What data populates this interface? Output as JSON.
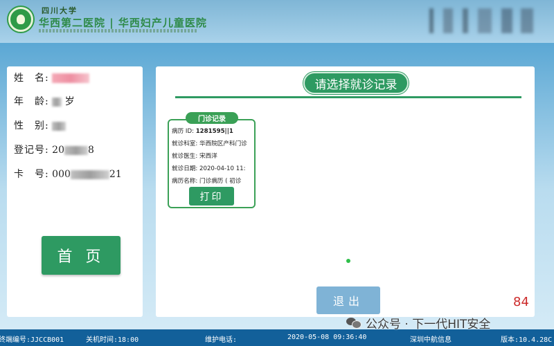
{
  "header": {
    "university": "四川大学",
    "hospital_name": "华西第二医院 | 华西妇产儿童医院"
  },
  "patient": {
    "name_label": "姓　名:",
    "age_label": "年　龄:",
    "age_unit": "岁",
    "gender_label": "性　别:",
    "reg_label": "登记号:",
    "reg_value_prefix": "20",
    "reg_value_suffix": "8",
    "card_label": "卡　号:",
    "card_value_prefix": "000",
    "card_value_suffix": "21"
  },
  "home_button": "首 页",
  "records": {
    "title": "请选择就诊记录",
    "card": {
      "tag": "门诊记录",
      "lines": [
        {
          "label": "病历 ID: ",
          "value": "1281595||1",
          "bold": true
        },
        {
          "label": "就诊科室: ",
          "value": "华西院区产科门诊"
        },
        {
          "label": "就诊医生: ",
          "value": "宋西洋"
        },
        {
          "label": "就诊日期: ",
          "value": "2020-04-10 11:"
        },
        {
          "label": "病历名称: ",
          "value": "门诊病历 ( 初诊"
        }
      ],
      "print_label": "打印"
    },
    "exit_label": "退出",
    "countdown": "84"
  },
  "footer": {
    "terminal": "终端编号:JJCCB001",
    "shutdown": "关机时间:18:00",
    "maintenance": "维护电话:",
    "datetime": "2020-05-08 09:36:40",
    "company": "深圳中航信息",
    "version": "版本:10.4.28C"
  },
  "watermark": "公众号 · 下一代HIT安全",
  "colors": {
    "primary_green": "#2e9a62",
    "footer_blue": "#12609a",
    "countdown_red": "#cc2a2a"
  }
}
